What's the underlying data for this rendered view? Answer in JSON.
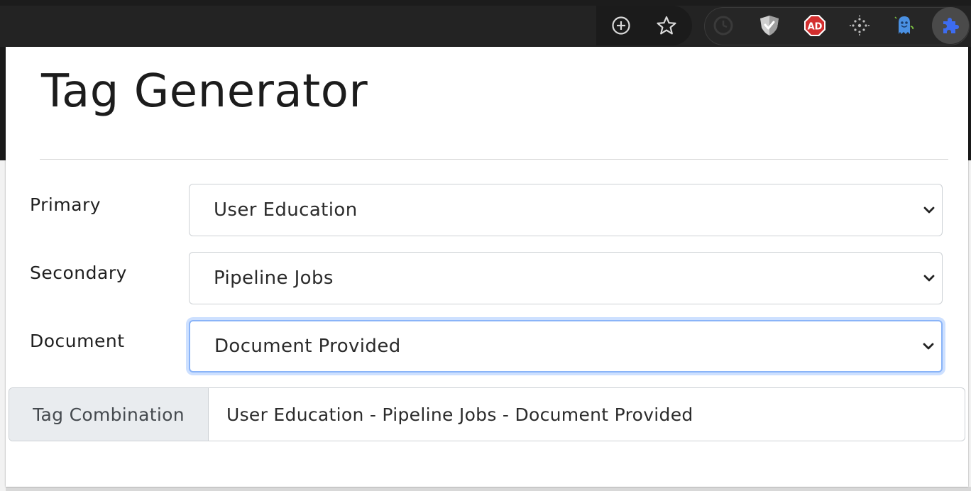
{
  "toolbar": {
    "icons": [
      "zoom-in-icon",
      "bookmark-star-icon",
      "clock-extension-icon",
      "shield-extension-icon",
      "adblock-extension-icon",
      "dots-extension-icon",
      "ghost-extension-icon",
      "puzzle-extensions-icon"
    ]
  },
  "popup": {
    "title": "Tag Generator",
    "primary": {
      "label": "Primary",
      "value": "User Education"
    },
    "secondary": {
      "label": "Secondary",
      "value": "Pipeline Jobs"
    },
    "document": {
      "label": "Document",
      "value": "Document Provided"
    },
    "combination": {
      "label": "Tag Combination",
      "value": "User Education - Pipeline Jobs - Document Provided"
    }
  },
  "colors": {
    "focus_ring": "#8ab4f8",
    "addon_bg": "#e9ecef",
    "adblock_red": "#d32f2f",
    "extension_blue": "#3d6cf0"
  }
}
